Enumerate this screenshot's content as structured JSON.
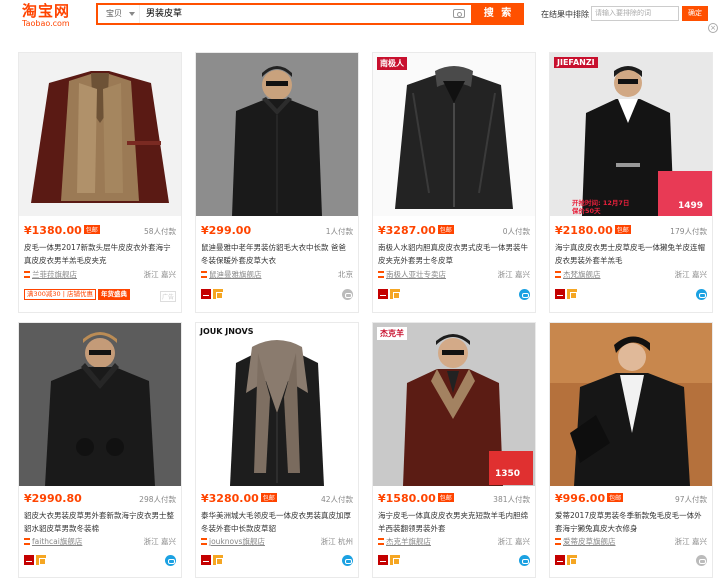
{
  "header": {
    "logo_cn": "淘宝网",
    "logo_en": "Taobao.com",
    "search_category": "宝贝",
    "search_query": "男装皮草",
    "search_button": "搜 索",
    "within_label": "在结果中排除",
    "within_placeholder": "请输入要排除的词",
    "confirm_button": "确定"
  },
  "products": [
    {
      "price": "¥1380.00",
      "baoyou": "包邮",
      "paid": "58人付款",
      "title": "皮毛一体男2017新款头层牛皮皮衣外套海宁真皮皮衣男羊羔毛皮夹克",
      "shop": "兰菲菈旗舰店",
      "location": "浙江 嘉兴",
      "promo1": "满300减30 | 店铺优惠",
      "promo2": "年货盛典",
      "ad": "广告"
    },
    {
      "price": "¥299.00",
      "paid": "1人付款",
      "title": "鼠迪曼雅中老年男装仿貂毛大衣中长款 爸爸冬装保暖外套皮草大衣",
      "title_hl": "男装",
      "shop": "鼠迪曼雅旗舰店",
      "location": "北京"
    },
    {
      "badge": "南极人",
      "price": "¥3287.00",
      "baoyou": "包邮",
      "paid": "0人付款",
      "title": "南极人水貂内胆真皮皮衣男式皮毛一体男装牛皮夹克外套男士冬皮草",
      "shop": "南极人亚壮专卖店",
      "location": "浙江 嘉兴"
    },
    {
      "badge": "JIEFANZI",
      "price": "¥2180.00",
      "baoyou": "包邮",
      "paid": "179人付款",
      "title": "海宁真皮皮衣男士皮草皮毛一体獭兔羊皮连帽皮衣男装外套羊羔毛",
      "shop": "杰梵旗舰店",
      "location": "浙江 嘉兴",
      "promo_price": "1499",
      "promo_text": "开抢时间: 12月7日",
      "promo_sub": "保价50天"
    },
    {
      "price": "¥2990.80",
      "paid": "298人付款",
      "title": "貂皮大衣男装皮草男外套新款海宁皮衣男士整貂水貂皮草男款冬装棉",
      "shop": "faithcai旗舰店",
      "location": "浙江 嘉兴"
    },
    {
      "badge": "JOUK JNOVS",
      "price": "¥3280.00",
      "baoyou": "包邮",
      "paid": "42人付款",
      "title": "泰华美洲城大毛领皮毛一体皮衣男装真皮加厚冬装外套中长款皮草貂",
      "shop": "jouknovs旗舰店",
      "location": "浙江 杭州"
    },
    {
      "badge": "杰克羊",
      "price": "¥1580.00",
      "baoyou": "包邮",
      "paid": "381人付款",
      "title": "海宁皮毛一体真皮皮衣男夹克短款羊毛内胆绵羊西装翻领男装外套",
      "shop": "杰克羊旗舰店",
      "location": "浙江 嘉兴",
      "promo_price": "1350"
    },
    {
      "price": "¥996.00",
      "baoyou": "包邮",
      "paid": "97人付款",
      "title": "爱蒂2017皮草男装冬季新款兔毛皮毛一体外套海宁獭兔真皮大衣修身",
      "shop": "爱蒂皮草旗舰店",
      "location": "浙江 嘉兴"
    }
  ],
  "colors": {
    "accent": "#ff5000",
    "price": "#ff4400",
    "text": "#3c3c3c",
    "muted": "#888888"
  }
}
